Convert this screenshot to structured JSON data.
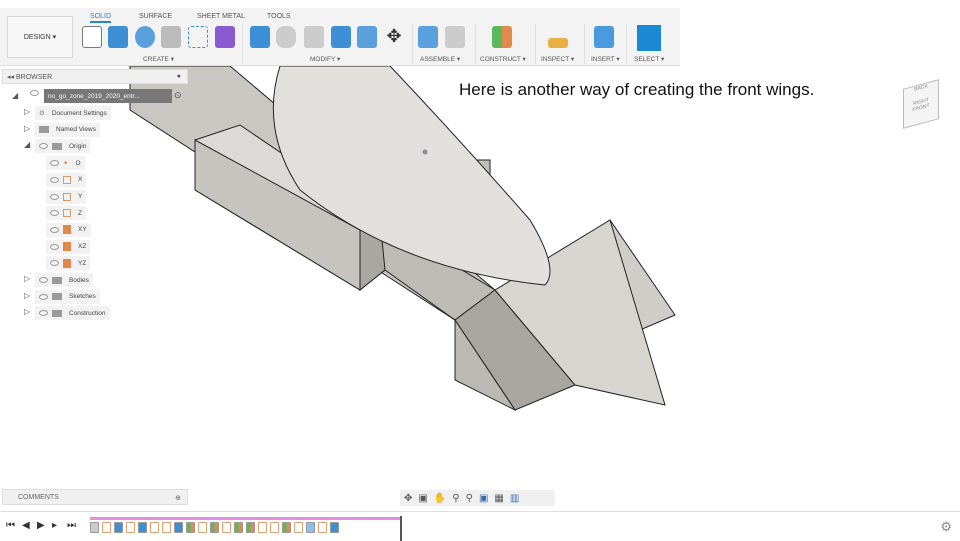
{
  "toolbar": {
    "design_label": "DESIGN ▾",
    "tabs": [
      "SOLID",
      "SURFACE",
      "SHEET METAL",
      "TOOLS"
    ],
    "groups": [
      "CREATE ▾",
      "MODIFY ▾",
      "ASSEMBLE ▾",
      "CONSTRUCT ▾",
      "INSPECT ▾",
      "INSERT ▾",
      "SELECT ▾"
    ]
  },
  "browser": {
    "title": "BROWSER",
    "root": "no_go_zone_2019_2020_entr...",
    "items": [
      {
        "label": "Document Settings"
      },
      {
        "label": "Named Views"
      },
      {
        "label": "Origin"
      },
      {
        "label": "O"
      },
      {
        "label": "X"
      },
      {
        "label": "Y"
      },
      {
        "label": "Z"
      },
      {
        "label": "XY"
      },
      {
        "label": "XZ"
      },
      {
        "label": "YZ"
      },
      {
        "label": "Bodies"
      },
      {
        "label": "Sketches"
      },
      {
        "label": "Construction"
      }
    ]
  },
  "caption": "Here is another way of creating the front wings.",
  "viewcube": {
    "faces": [
      "BACK",
      "RIGHT",
      "FRONT"
    ]
  },
  "comments": {
    "label": "COMMENTS"
  },
  "timeline": {
    "items": [
      "body",
      "sketch",
      "extrude",
      "sketch",
      "extrude",
      "sketch",
      "sketch",
      "extrude",
      "plane",
      "sketch",
      "plane",
      "sketch",
      "plane",
      "plane",
      "sketch",
      "sketch",
      "plane",
      "sketch",
      "shell",
      "sketch",
      "extrude"
    ]
  },
  "colors": {
    "accent": "#2a82c8",
    "timeline_bar": "#e58be0",
    "model": "#d4d2cd"
  }
}
